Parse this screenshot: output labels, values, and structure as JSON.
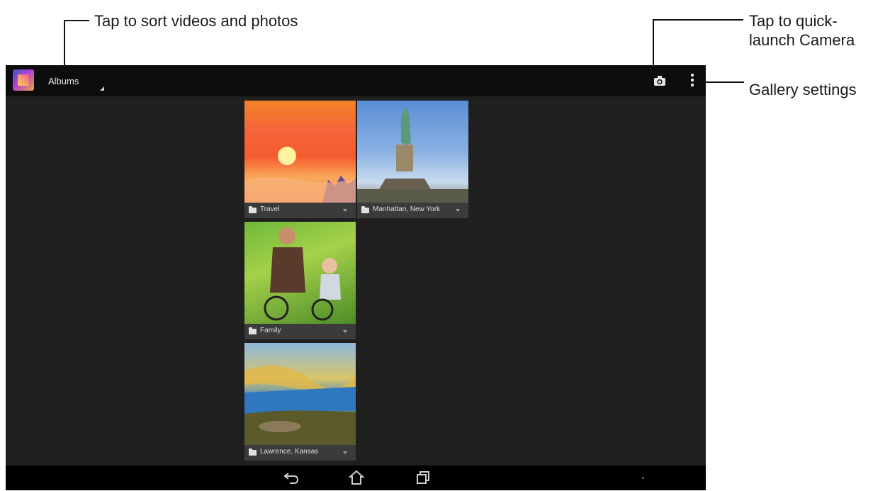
{
  "callouts": {
    "sort": "Tap to sort videos and photos",
    "camera_line1": "Tap to quick-",
    "camera_line2": "launch Camera",
    "settings": "Gallery settings"
  },
  "actionbar": {
    "title": "Albums",
    "icons": [
      "gallery-app-icon",
      "camera-icon",
      "overflow-menu-icon"
    ]
  },
  "albums": [
    {
      "name": "Travel"
    },
    {
      "name": "Manhattan, New York"
    },
    {
      "name": "Family"
    },
    {
      "name": "Lawrence, Kansas"
    }
  ],
  "navbar": {
    "icons": [
      "back-icon",
      "home-icon",
      "recent-apps-icon"
    ]
  },
  "colors": {
    "screen_bg": "#1f1f1f",
    "actionbar_bg": "#0d0d0d",
    "caption_bg": "#3b3b3b"
  }
}
